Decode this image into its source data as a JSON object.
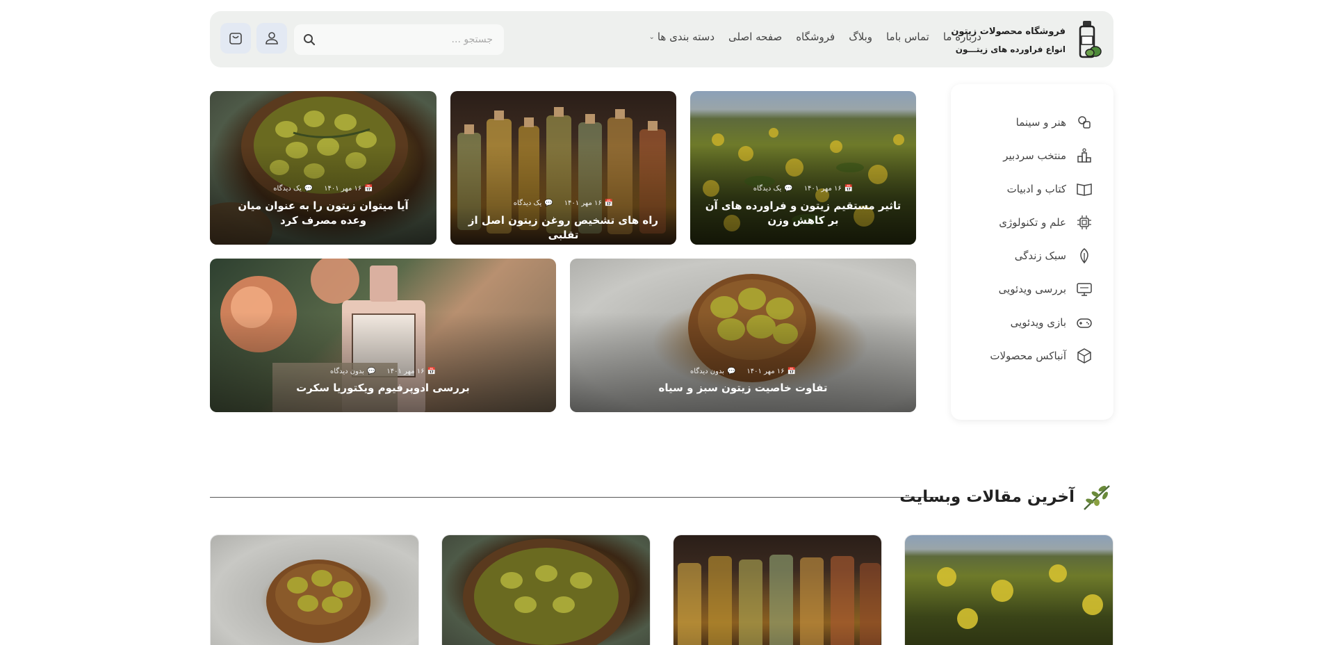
{
  "header": {
    "brand_title": "فروشگاه محصولات زیتون",
    "brand_subtitle": "انواع فراورده های زیتـــون",
    "nav": [
      {
        "label": "دسته بندی ها",
        "has_dropdown": true
      },
      {
        "label": "صفحه اصلی"
      },
      {
        "label": "فروشگاه"
      },
      {
        "label": "وبلاگ"
      },
      {
        "label": "تماس باما"
      },
      {
        "label": "درباره ما"
      }
    ],
    "search_placeholder": "جستجو ..."
  },
  "sidebar": {
    "categories": [
      {
        "label": "هنر و سینما",
        "icon": "film-icon"
      },
      {
        "label": "منتخب سردبیر",
        "icon": "ranking-icon"
      },
      {
        "label": "کتاب و ادبیات",
        "icon": "book-icon"
      },
      {
        "label": "علم و تکنولوژی",
        "icon": "chip-icon"
      },
      {
        "label": "سبک زندگی",
        "icon": "leaf-icon"
      },
      {
        "label": "بررسی ویدئویی",
        "icon": "monitor-icon"
      },
      {
        "label": "بازی ویدئویی",
        "icon": "gamepad-icon"
      },
      {
        "label": "آنباکس محصولات",
        "icon": "box-icon"
      }
    ]
  },
  "featured": [
    {
      "title": "تاثیر مستقیم زیتون و فراورده های آن بر کاهش وزن",
      "date": "۱۶ مهر ۱۴۰۱",
      "comments": "یک دیدگاه"
    },
    {
      "title": "راه های تشخیص روغن زیتون اصل از تقلبی",
      "date": "۱۶ مهر ۱۴۰۱",
      "comments": "یک دیدگاه"
    },
    {
      "title": "آیا میتوان زیتون را به عنوان میان وعده مصرف کرد",
      "date": "۱۶ مهر ۱۴۰۱",
      "comments": "یک دیدگاه"
    },
    {
      "title": "تفاوت خاصیت زیتون سبز و سیاه",
      "date": "۱۶ مهر ۱۴۰۱",
      "comments": "بدون دیدگاه"
    },
    {
      "title": "بررسی ادوپرفیوم ویکتوریا سکرت",
      "date": "۱۶ مهر ۱۴۰۱",
      "comments": "بدون دیدگاه"
    }
  ],
  "latest": {
    "title": "آخرین مقالات وبسایت"
  },
  "colors": {
    "header_bg": "#eef0ee",
    "accent_green": "#4d6a3a",
    "icon_btn_bg": "#e3e9f3"
  }
}
